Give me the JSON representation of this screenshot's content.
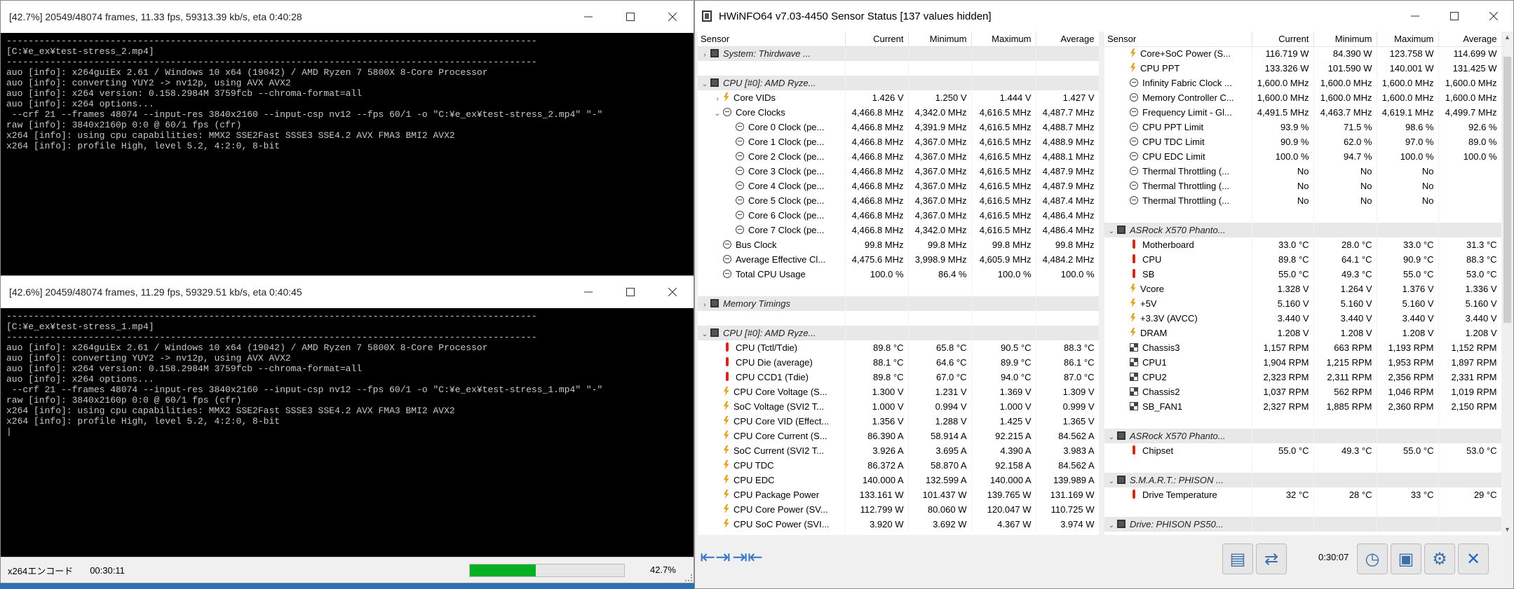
{
  "console1": {
    "title": "[42.7%] 20549/48074 frames, 11.33 fps, 59313.39 kb/s, eta 0:40:28",
    "lines": "-------------------------------------------------------------------------------------------------\n[C:¥e_ex¥test-stress_2.mp4]\n-------------------------------------------------------------------------------------------------\nauo [info]: x264guiEx 2.61 / Windows 10 x64 (19042) / AMD Ryzen 7 5800X 8-Core Processor\nauo [info]: converting YUY2 -> nv12p, using AVX AVX2\nauo [info]: x264 version: 0.158.2984M 3759fcb --chroma-format=all\nauo [info]: x264 options...\n --crf 21 --frames 48074 --input-res 3840x2160 --input-csp nv12 --fps 60/1 -o \"C:¥e_ex¥test-stress_2.mp4\" \"-\"\nraw [info]: 3840x2160p 0:0 @ 60/1 fps (cfr)\nx264 [info]: using cpu capabilities: MMX2 SSE2Fast SSSE3 SSE4.2 AVX FMA3 BMI2 AVX2\nx264 [info]: profile High, level 5.2, 4:2:0, 8-bit"
  },
  "console2": {
    "title": "[42.6%] 20459/48074 frames, 11.29 fps, 59329.51 kb/s, eta 0:40:45",
    "lines": "-------------------------------------------------------------------------------------------------\n[C:¥e_ex¥test-stress_1.mp4]\n-------------------------------------------------------------------------------------------------\nauo [info]: x264guiEx 2.61 / Windows 10 x64 (19042) / AMD Ryzen 7 5800X 8-Core Processor\nauo [info]: converting YUY2 -> nv12p, using AVX AVX2\nauo [info]: x264 version: 0.158.2984M 3759fcb --chroma-format=all\nauo [info]: x264 options...\n --crf 21 --frames 48074 --input-res 3840x2160 --input-csp nv12 --fps 60/1 -o \"C:¥e_ex¥test-stress_1.mp4\" \"-\"\nraw [info]: 3840x2160p 0:0 @ 60/1 fps (cfr)\nx264 [info]: using cpu capabilities: MMX2 SSE2Fast SSSE3 SSE4.2 AVX FMA3 BMI2 AVX2\nx264 [info]: profile High, level 5.2, 4:2:0, 8-bit\n|",
    "status_title": "x264エンコード",
    "status_time": "00:30:11",
    "progress_percent": 42.7,
    "progress_label": "42.7%"
  },
  "hwinfo": {
    "title": "HWiNFO64 v7.03-4450 Sensor Status [137 values hidden]",
    "columns": [
      "Sensor",
      "Current",
      "Minimum",
      "Maximum",
      "Average"
    ],
    "left_rows": [
      {
        "type": "group",
        "exp": "›",
        "icon": "chip",
        "name": "System: Thirdwave ...",
        "cur": "",
        "min": "",
        "max": "",
        "avg": ""
      },
      {
        "type": "blank"
      },
      {
        "type": "group",
        "exp": "⌄",
        "icon": "chip",
        "name": "CPU [#0]: AMD Ryze...",
        "cur": "",
        "min": "",
        "max": "",
        "avg": ""
      },
      {
        "type": "row",
        "indent": 1,
        "exp": "›",
        "icon": "bolt",
        "name": "Core VIDs",
        "cur": "1.426 V",
        "min": "1.250 V",
        "max": "1.444 V",
        "avg": "1.427 V"
      },
      {
        "type": "row",
        "indent": 1,
        "exp": "⌄",
        "icon": "clock",
        "name": "Core Clocks",
        "cur": "4,466.8 MHz",
        "min": "4,342.0 MHz",
        "max": "4,616.5 MHz",
        "avg": "4,487.7 MHz"
      },
      {
        "type": "row",
        "indent": 2,
        "icon": "clock",
        "name": "Core 0 Clock (pe...",
        "cur": "4,466.8 MHz",
        "min": "4,391.9 MHz",
        "max": "4,616.5 MHz",
        "avg": "4,488.7 MHz"
      },
      {
        "type": "row",
        "indent": 2,
        "icon": "clock",
        "name": "Core 1 Clock (pe...",
        "cur": "4,466.8 MHz",
        "min": "4,367.0 MHz",
        "max": "4,616.5 MHz",
        "avg": "4,488.9 MHz"
      },
      {
        "type": "row",
        "indent": 2,
        "icon": "clock",
        "name": "Core 2 Clock (pe...",
        "cur": "4,466.8 MHz",
        "min": "4,367.0 MHz",
        "max": "4,616.5 MHz",
        "avg": "4,488.1 MHz"
      },
      {
        "type": "row",
        "indent": 2,
        "icon": "clock",
        "name": "Core 3 Clock (pe...",
        "cur": "4,466.8 MHz",
        "min": "4,367.0 MHz",
        "max": "4,616.5 MHz",
        "avg": "4,487.9 MHz"
      },
      {
        "type": "row",
        "indent": 2,
        "icon": "clock",
        "name": "Core 4 Clock (pe...",
        "cur": "4,466.8 MHz",
        "min": "4,367.0 MHz",
        "max": "4,616.5 MHz",
        "avg": "4,487.9 MHz"
      },
      {
        "type": "row",
        "indent": 2,
        "icon": "clock",
        "name": "Core 5 Clock (pe...",
        "cur": "4,466.8 MHz",
        "min": "4,367.0 MHz",
        "max": "4,616.5 MHz",
        "avg": "4,487.4 MHz"
      },
      {
        "type": "row",
        "indent": 2,
        "icon": "clock",
        "name": "Core 6 Clock (pe...",
        "cur": "4,466.8 MHz",
        "min": "4,367.0 MHz",
        "max": "4,616.5 MHz",
        "avg": "4,486.4 MHz"
      },
      {
        "type": "row",
        "indent": 2,
        "icon": "clock",
        "name": "Core 7 Clock (pe...",
        "cur": "4,466.8 MHz",
        "min": "4,342.0 MHz",
        "max": "4,616.5 MHz",
        "avg": "4,486.4 MHz"
      },
      {
        "type": "row",
        "indent": 1,
        "icon": "clock",
        "name": "Bus Clock",
        "cur": "99.8 MHz",
        "min": "99.8 MHz",
        "max": "99.8 MHz",
        "avg": "99.8 MHz"
      },
      {
        "type": "row",
        "indent": 1,
        "icon": "clock",
        "name": "Average Effective Cl...",
        "cur": "4,475.6 MHz",
        "min": "3,998.9 MHz",
        "max": "4,605.9 MHz",
        "avg": "4,484.2 MHz"
      },
      {
        "type": "row",
        "indent": 1,
        "icon": "clock",
        "name": "Total CPU Usage",
        "cur": "100.0 %",
        "min": "86.4 %",
        "max": "100.0 %",
        "avg": "100.0 %"
      },
      {
        "type": "blank"
      },
      {
        "type": "group",
        "exp": "›",
        "icon": "chip",
        "name": "Memory Timings",
        "cur": "",
        "min": "",
        "max": "",
        "avg": ""
      },
      {
        "type": "blank"
      },
      {
        "type": "group",
        "exp": "⌄",
        "icon": "chip",
        "name": "CPU [#0]: AMD Ryze...",
        "cur": "",
        "min": "",
        "max": "",
        "avg": ""
      },
      {
        "type": "row",
        "indent": 1,
        "icon": "therm",
        "name": "CPU (Tctl/Tdie)",
        "cur": "89.8 °C",
        "min": "65.8 °C",
        "max": "90.5 °C",
        "avg": "88.3 °C"
      },
      {
        "type": "row",
        "indent": 1,
        "icon": "therm",
        "name": "CPU Die (average)",
        "cur": "88.1 °C",
        "min": "64.6 °C",
        "max": "89.9 °C",
        "avg": "86.1 °C"
      },
      {
        "type": "row",
        "indent": 1,
        "icon": "therm",
        "name": "CPU CCD1 (Tdie)",
        "cur": "89.8 °C",
        "min": "67.0 °C",
        "max": "94.0 °C",
        "avg": "87.0 °C"
      },
      {
        "type": "row",
        "indent": 1,
        "icon": "bolt",
        "name": "CPU Core Voltage (S...",
        "cur": "1.300 V",
        "min": "1.231 V",
        "max": "1.369 V",
        "avg": "1.309 V"
      },
      {
        "type": "row",
        "indent": 1,
        "icon": "bolt",
        "name": "SoC Voltage (SVI2 T...",
        "cur": "1.000 V",
        "min": "0.994 V",
        "max": "1.000 V",
        "avg": "0.999 V"
      },
      {
        "type": "row",
        "indent": 1,
        "icon": "bolt",
        "name": "CPU Core VID (Effect...",
        "cur": "1.356 V",
        "min": "1.288 V",
        "max": "1.425 V",
        "avg": "1.365 V"
      },
      {
        "type": "row",
        "indent": 1,
        "icon": "bolt",
        "name": "CPU Core Current (S...",
        "cur": "86.390 A",
        "min": "58.914 A",
        "max": "92.215 A",
        "avg": "84.562 A"
      },
      {
        "type": "row",
        "indent": 1,
        "icon": "bolt",
        "name": "SoC Current (SVI2 T...",
        "cur": "3.926 A",
        "min": "3.695 A",
        "max": "4.390 A",
        "avg": "3.983 A"
      },
      {
        "type": "row",
        "indent": 1,
        "icon": "bolt",
        "name": "CPU TDC",
        "cur": "86.372 A",
        "min": "58.870 A",
        "max": "92.158 A",
        "avg": "84.562 A"
      },
      {
        "type": "row",
        "indent": 1,
        "icon": "bolt",
        "name": "CPU EDC",
        "cur": "140.000 A",
        "min": "132.599 A",
        "max": "140.000 A",
        "avg": "139.989 A"
      },
      {
        "type": "row",
        "indent": 1,
        "icon": "bolt",
        "name": "CPU Package Power",
        "cur": "133.161 W",
        "min": "101.437 W",
        "max": "139.765 W",
        "avg": "131.169 W"
      },
      {
        "type": "row",
        "indent": 1,
        "icon": "bolt",
        "name": "CPU Core Power (SV...",
        "cur": "112.799 W",
        "min": "80.060 W",
        "max": "120.047 W",
        "avg": "110.725 W"
      },
      {
        "type": "row",
        "indent": 1,
        "icon": "bolt",
        "name": "CPU SoC Power (SVI...",
        "cur": "3.920 W",
        "min": "3.692 W",
        "max": "4.367 W",
        "avg": "3.974 W"
      }
    ],
    "right_rows": [
      {
        "type": "row",
        "indent": 1,
        "icon": "bolt",
        "name": "Core+SoC Power (S...",
        "cur": "116.719 W",
        "min": "84.390 W",
        "max": "123.758 W",
        "avg": "114.699 W"
      },
      {
        "type": "row",
        "indent": 1,
        "icon": "bolt",
        "name": "CPU PPT",
        "cur": "133.326 W",
        "min": "101.590 W",
        "max": "140.001 W",
        "avg": "131.425 W"
      },
      {
        "type": "row",
        "indent": 1,
        "icon": "clock",
        "name": "Infinity Fabric Clock ...",
        "cur": "1,600.0 MHz",
        "min": "1,600.0 MHz",
        "max": "1,600.0 MHz",
        "avg": "1,600.0 MHz"
      },
      {
        "type": "row",
        "indent": 1,
        "icon": "clock",
        "name": "Memory Controller C...",
        "cur": "1,600.0 MHz",
        "min": "1,600.0 MHz",
        "max": "1,600.0 MHz",
        "avg": "1,600.0 MHz"
      },
      {
        "type": "row",
        "indent": 1,
        "icon": "clock",
        "name": "Frequency Limit - Gl...",
        "cur": "4,491.5 MHz",
        "min": "4,463.7 MHz",
        "max": "4,619.1 MHz",
        "avg": "4,499.7 MHz"
      },
      {
        "type": "row",
        "indent": 1,
        "icon": "clock",
        "name": "CPU PPT Limit",
        "cur": "93.9 %",
        "min": "71.5 %",
        "max": "98.6 %",
        "avg": "92.6 %"
      },
      {
        "type": "row",
        "indent": 1,
        "icon": "clock",
        "name": "CPU TDC Limit",
        "cur": "90.9 %",
        "min": "62.0 %",
        "max": "97.0 %",
        "avg": "89.0 %"
      },
      {
        "type": "row",
        "indent": 1,
        "icon": "clock",
        "name": "CPU EDC Limit",
        "cur": "100.0 %",
        "min": "94.7 %",
        "max": "100.0 %",
        "avg": "100.0 %"
      },
      {
        "type": "row",
        "indent": 1,
        "icon": "clock",
        "name": "Thermal Throttling (...",
        "cur": "No",
        "min": "No",
        "max": "No",
        "avg": ""
      },
      {
        "type": "row",
        "indent": 1,
        "icon": "clock",
        "name": "Thermal Throttling (...",
        "cur": "No",
        "min": "No",
        "max": "No",
        "avg": ""
      },
      {
        "type": "row",
        "indent": 1,
        "icon": "clock",
        "name": "Thermal Throttling (...",
        "cur": "No",
        "min": "No",
        "max": "No",
        "avg": ""
      },
      {
        "type": "blank"
      },
      {
        "type": "group",
        "exp": "⌄",
        "icon": "chip",
        "name": "ASRock X570 Phanto...",
        "cur": "",
        "min": "",
        "max": "",
        "avg": ""
      },
      {
        "type": "row",
        "indent": 1,
        "icon": "therm",
        "name": "Motherboard",
        "cur": "33.0 °C",
        "min": "28.0 °C",
        "max": "33.0 °C",
        "avg": "31.3 °C"
      },
      {
        "type": "row",
        "indent": 1,
        "icon": "therm",
        "name": "CPU",
        "cur": "89.8 °C",
        "min": "64.1 °C",
        "max": "90.9 °C",
        "avg": "88.3 °C"
      },
      {
        "type": "row",
        "indent": 1,
        "icon": "therm",
        "name": "SB",
        "cur": "55.0 °C",
        "min": "49.3 °C",
        "max": "55.0 °C",
        "avg": "53.0 °C"
      },
      {
        "type": "row",
        "indent": 1,
        "icon": "bolt",
        "name": "Vcore",
        "cur": "1.328 V",
        "min": "1.264 V",
        "max": "1.376 V",
        "avg": "1.336 V"
      },
      {
        "type": "row",
        "indent": 1,
        "icon": "bolt",
        "name": "+5V",
        "cur": "5.160 V",
        "min": "5.160 V",
        "max": "5.160 V",
        "avg": "5.160 V"
      },
      {
        "type": "row",
        "indent": 1,
        "icon": "bolt",
        "name": "+3.3V (AVCC)",
        "cur": "3.440 V",
        "min": "3.440 V",
        "max": "3.440 V",
        "avg": "3.440 V"
      },
      {
        "type": "row",
        "indent": 1,
        "icon": "bolt",
        "name": "DRAM",
        "cur": "1.208 V",
        "min": "1.208 V",
        "max": "1.208 V",
        "avg": "1.208 V"
      },
      {
        "type": "row",
        "indent": 1,
        "icon": "fan",
        "name": "Chassis3",
        "cur": "1,157 RPM",
        "min": "663 RPM",
        "max": "1,193 RPM",
        "avg": "1,152 RPM"
      },
      {
        "type": "row",
        "indent": 1,
        "icon": "fan",
        "name": "CPU1",
        "cur": "1,904 RPM",
        "min": "1,215 RPM",
        "max": "1,953 RPM",
        "avg": "1,897 RPM"
      },
      {
        "type": "row",
        "indent": 1,
        "icon": "fan",
        "name": "CPU2",
        "cur": "2,323 RPM",
        "min": "2,311 RPM",
        "max": "2,356 RPM",
        "avg": "2,331 RPM"
      },
      {
        "type": "row",
        "indent": 1,
        "icon": "fan",
        "name": "Chassis2",
        "cur": "1,037 RPM",
        "min": "562 RPM",
        "max": "1,046 RPM",
        "avg": "1,019 RPM"
      },
      {
        "type": "row",
        "indent": 1,
        "icon": "fan",
        "name": "SB_FAN1",
        "cur": "2,327 RPM",
        "min": "1,885 RPM",
        "max": "2,360 RPM",
        "avg": "2,150 RPM"
      },
      {
        "type": "blank"
      },
      {
        "type": "group",
        "exp": "⌄",
        "icon": "chip",
        "name": "ASRock X570 Phanto...",
        "cur": "",
        "min": "",
        "max": "",
        "avg": ""
      },
      {
        "type": "row",
        "indent": 1,
        "icon": "therm",
        "name": "Chipset",
        "cur": "55.0 °C",
        "min": "49.3 °C",
        "max": "55.0 °C",
        "avg": "53.0 °C"
      },
      {
        "type": "blank"
      },
      {
        "type": "group",
        "exp": "⌄",
        "icon": "chip",
        "name": "S.M.A.R.T.: PHISON ...",
        "cur": "",
        "min": "",
        "max": "",
        "avg": ""
      },
      {
        "type": "row",
        "indent": 1,
        "icon": "therm",
        "name": "Drive Temperature",
        "cur": "32 °C",
        "min": "28 °C",
        "max": "33 °C",
        "avg": "29 °C"
      },
      {
        "type": "blank"
      },
      {
        "type": "group",
        "exp": "⌄",
        "icon": "chip",
        "name": "Drive: PHISON PS50...",
        "cur": "",
        "min": "",
        "max": "",
        "avg": ""
      }
    ],
    "elapsed": "0:30:07"
  },
  "colors": {
    "desktop": "#2d6fb4",
    "progress": "#06b025",
    "group_bg": "#e8e8e8"
  }
}
